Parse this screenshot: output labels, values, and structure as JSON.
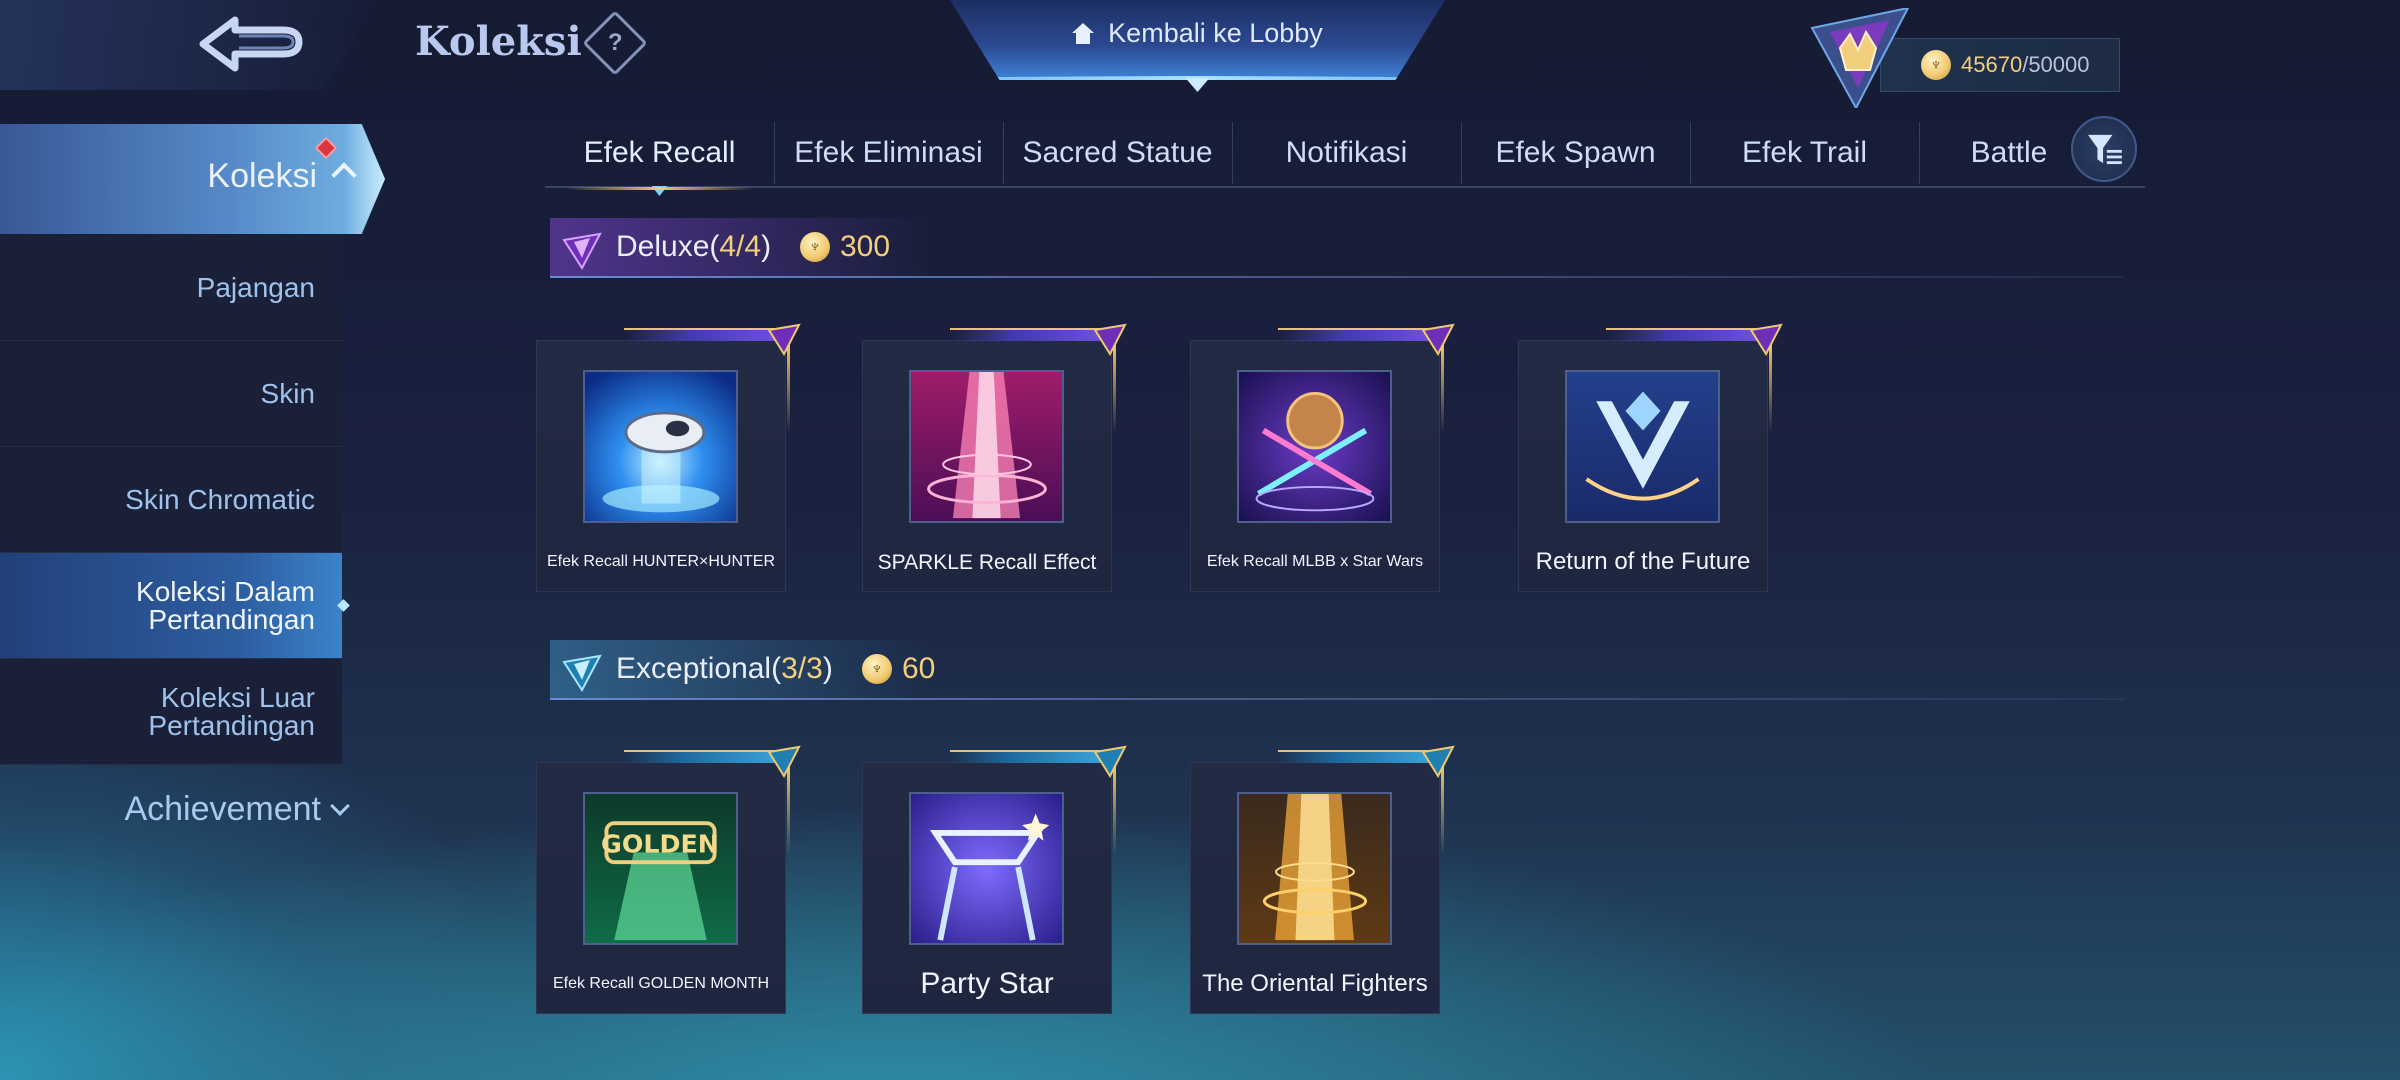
{
  "header": {
    "title": "Koleksi",
    "help_symbol": "?",
    "lobby_button": "Kembali ke Lobby",
    "points": {
      "current": "45670",
      "separator": "/",
      "max": "50000"
    }
  },
  "sidebar": {
    "main": {
      "label": "Koleksi"
    },
    "items": [
      {
        "label": "Pajangan"
      },
      {
        "label": "Skin"
      },
      {
        "label": "Skin Chromatic"
      },
      {
        "label": "Koleksi Dalam Pertandingan"
      },
      {
        "label": "Koleksi Luar Pertandingan"
      }
    ],
    "achievement": "Achievement"
  },
  "tabs": [
    {
      "label": "Efek Recall"
    },
    {
      "label": "Efek Eliminasi"
    },
    {
      "label": "Sacred Statue"
    },
    {
      "label": "Notifikasi"
    },
    {
      "label": "Efek Spawn"
    },
    {
      "label": "Efek Trail"
    },
    {
      "label": "Battle"
    }
  ],
  "sections": {
    "deluxe": {
      "title": "Deluxe(",
      "count": "4/4",
      "close": ")",
      "cost": "300",
      "items": [
        {
          "name": "Efek Recall HUNTER×HUNTER"
        },
        {
          "name": "SPARKLE Recall Effect"
        },
        {
          "name": "Efek Recall MLBB x Star Wars"
        },
        {
          "name": "Return of the Future"
        }
      ]
    },
    "exceptional": {
      "title": "Exceptional(",
      "count": "3/3",
      "close": ")",
      "cost": "60",
      "items": [
        {
          "name": "Efek Recall GOLDEN MONTH"
        },
        {
          "name": "Party Star"
        },
        {
          "name": "The Oriental Fighters"
        }
      ]
    }
  },
  "colors": {
    "accent_gold": "#f2cf7e",
    "active_blue": "#3b83c9",
    "deluxe_purple": "#6e4fe0",
    "exceptional_teal": "#3aa2d6",
    "notification_red": "#d9383f"
  },
  "icons": {
    "back": "back-arrow-icon",
    "help": "question-diamond-icon",
    "home": "home-icon",
    "coin": "collection-point-coin-icon",
    "filter": "filter-icon",
    "deluxe": "deluxe-gem-icon",
    "exceptional": "exceptional-gem-icon"
  }
}
